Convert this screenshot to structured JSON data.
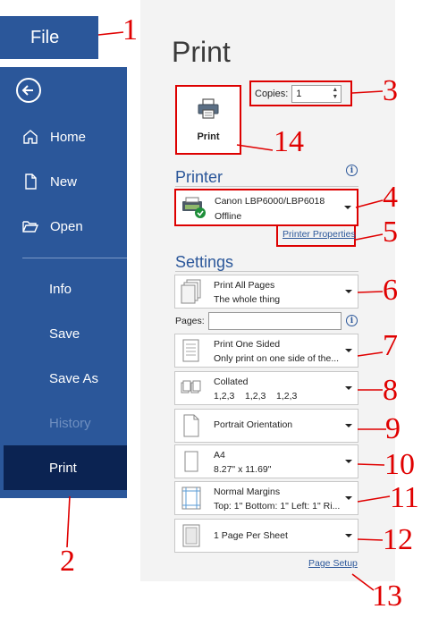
{
  "nav": {
    "file_label": "File",
    "items": [
      {
        "label": "Home",
        "icon": "home-icon"
      },
      {
        "label": "New",
        "icon": "new-document-icon"
      },
      {
        "label": "Open",
        "icon": "open-folder-icon"
      },
      {
        "label": "Info"
      },
      {
        "label": "Save"
      },
      {
        "label": "Save As"
      },
      {
        "label": "History",
        "disabled": true
      },
      {
        "label": "Print",
        "active": true
      }
    ]
  },
  "print": {
    "title": "Print",
    "button_label": "Print",
    "copies_label": "Copies:",
    "copies_value": "1"
  },
  "printer": {
    "section": "Printer",
    "name": "Canon LBP6000/LBP6018",
    "status": "Offline",
    "properties_link": "Printer Properties"
  },
  "settings": {
    "section": "Settings",
    "pages_label": "Pages:",
    "pages_value": "",
    "dropdowns": [
      {
        "line1": "Print All Pages",
        "line2": "The whole thing"
      },
      {
        "line1": "Print One Sided",
        "line2": "Only print on one side of the..."
      },
      {
        "line1": "Collated",
        "line2": "1,2,3    1,2,3    1,2,3"
      },
      {
        "line1": "Portrait Orientation",
        "line2": ""
      },
      {
        "line1": "A4",
        "line2": "8.27\" x 11.69\""
      },
      {
        "line1": "Normal Margins",
        "line2": "Top: 1\" Bottom: 1\" Left: 1\" Ri..."
      },
      {
        "line1": "1 Page Per Sheet",
        "line2": ""
      }
    ],
    "page_setup_link": "Page Setup"
  },
  "annotations": [
    "1",
    "2",
    "3",
    "4",
    "5",
    "6",
    "7",
    "8",
    "9",
    "10",
    "11",
    "12",
    "13",
    "14"
  ],
  "colors": {
    "nav_bg": "#2b579a",
    "nav_active": "#0b2352",
    "panel_bg": "#f3f3f3",
    "annotation": "#e00000"
  }
}
